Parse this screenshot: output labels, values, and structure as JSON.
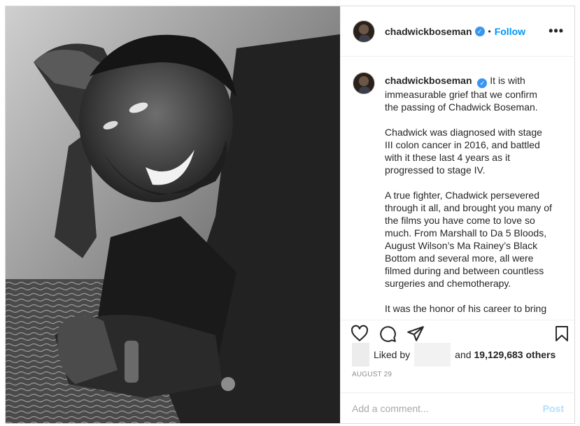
{
  "header": {
    "username": "chadwickboseman",
    "verified_icon": "verified-badge-icon",
    "separator": "•",
    "follow_label": "Follow",
    "more_icon": "more-options-icon"
  },
  "caption": {
    "username": "chadwickboseman",
    "paragraphs": [
      "It is with immeasurable grief that we confirm the passing of Chadwick Boseman.",
      "Chadwick was diagnosed with stage III colon cancer in 2016, and battled with it these last 4 years as it progressed to stage IV.",
      "A true fighter, Chadwick persevered through it all, and brought you many of the films you have come to love so much. From Marshall to Da 5 Bloods, August Wilson’s Ma Rainey’s Black Bottom and several more, all were filmed during and between countless surgeries and chemotherapy.",
      "It was the honor of his career to bring"
    ]
  },
  "actions": {
    "like_icon": "heart-icon",
    "comment_icon": "comment-icon",
    "share_icon": "share-icon",
    "save_icon": "bookmark-icon"
  },
  "likes": {
    "prefix": "Liked by",
    "conjunction": "and",
    "count": "19,129,683 others"
  },
  "date": "August 29",
  "comment": {
    "placeholder": "Add a comment...",
    "post_label": "Post"
  },
  "colors": {
    "accent": "#0095f6",
    "verified": "#3897f0",
    "post_disabled": "#b2dffc",
    "meta_gray": "#8e8e8e"
  }
}
